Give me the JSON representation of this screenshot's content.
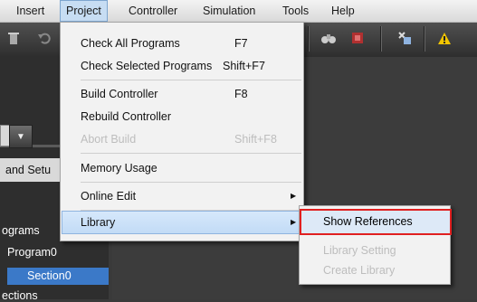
{
  "menubar": {
    "items": [
      "Insert",
      "Project",
      "Controller",
      "Simulation",
      "Tools",
      "Help"
    ],
    "active_index": 1
  },
  "toolbar": {
    "icons": [
      "trash-icon",
      "undo-icon",
      "binoculars-icon",
      "stop-icon",
      "cross-reference-icon",
      "warning-icon"
    ]
  },
  "left_pane": {
    "tab_label": "and Setu",
    "tree": [
      "ograms",
      "Program0",
      "Section0",
      "ections"
    ]
  },
  "project_menu": {
    "items": [
      {
        "label": "Check All Programs",
        "shortcut": "F7",
        "enabled": true
      },
      {
        "label": "Check Selected Programs",
        "shortcut": "Shift+F7",
        "enabled": true
      },
      {
        "label": "Build Controller",
        "shortcut": "F8",
        "enabled": true
      },
      {
        "label": "Rebuild Controller",
        "shortcut": "",
        "enabled": true
      },
      {
        "label": "Abort Build",
        "shortcut": "Shift+F8",
        "enabled": false
      },
      {
        "label": "Memory Usage",
        "shortcut": "",
        "enabled": true
      },
      {
        "label": "Online Edit",
        "shortcut": "",
        "enabled": true,
        "submenu": true
      },
      {
        "label": "Library",
        "shortcut": "",
        "enabled": true,
        "submenu": true,
        "highlighted": true
      }
    ]
  },
  "library_submenu": {
    "items": [
      {
        "label": "Show References",
        "enabled": true,
        "highlighted": true
      },
      {
        "label": "Library Setting",
        "enabled": false
      },
      {
        "label": "Create Library",
        "enabled": false
      }
    ]
  },
  "colors": {
    "highlight_box": "#e02020",
    "selection": "#3b79c8",
    "warning": "#f2c500"
  }
}
